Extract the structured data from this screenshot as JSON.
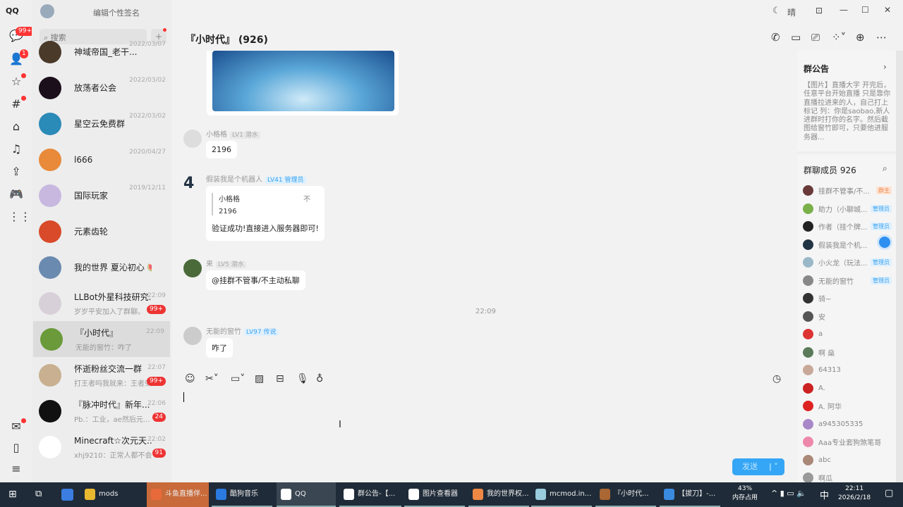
{
  "app": {
    "logo": "QQ",
    "signature": "编辑个性签名",
    "weather": "晴",
    "nav_badge": "99+",
    "contacts_badge": "1"
  },
  "search": {
    "placeholder": "搜索"
  },
  "conversations": [
    {
      "name": "神域帝国_老干...",
      "time": "2022/03/07",
      "sub": "",
      "badge": "",
      "color": "#4a3a2a"
    },
    {
      "name": "放荡者公会",
      "time": "2022/03/02",
      "sub": "",
      "badge": "",
      "color": "#1a0f1a"
    },
    {
      "name": "星空云免费群",
      "time": "2022/03/02",
      "sub": "",
      "badge": "",
      "color": "#2a8ab8"
    },
    {
      "name": "l666",
      "time": "2020/04/27",
      "sub": "",
      "badge": "",
      "color": "#e88a3a"
    },
    {
      "name": "国际玩家",
      "time": "2019/12/11",
      "sub": "",
      "badge": "",
      "color": "#c8b8e0"
    },
    {
      "name": "元素齿轮",
      "time": "",
      "sub": "",
      "badge": "",
      "color": "#d84a2a"
    },
    {
      "name": "我的世界 夏沁初心 🍉",
      "time": "",
      "sub": "",
      "badge": "",
      "color": "#6a8ab0"
    },
    {
      "name": "LLBot外星科技研究...",
      "time": "22:09",
      "sub": "岁岁平安加入了群聊。",
      "badge": "99+",
      "color": "#d8d0d8"
    },
    {
      "name": "『小时代』",
      "time": "22:09",
      "sub": "无能的窗竹：咋了",
      "badge": "",
      "color": "#6a9a3a",
      "selected": true
    },
    {
      "name": "怀逝粉丝交流一群",
      "time": "22:07",
      "sub": "打王者吗我就来：王者荣...",
      "badge": "99+",
      "color": "#c8b090"
    },
    {
      "name": "『脉冲时代』新年...",
      "time": "22:06",
      "sub": "Pb.：工业，ae然后元...",
      "badge": "24",
      "color": "#111"
    },
    {
      "name": "Minecraft☆次元天...",
      "time": "22:02",
      "sub": "xhj9210：正常人都不会买吧",
      "badge": "91",
      "color": "#fff"
    }
  ],
  "chat": {
    "title": "『小时代』 (926)",
    "messages": [
      {
        "sender": "小格格",
        "level": "LV1 潜水",
        "text": "2196"
      },
      {
        "sender": "假装我是个机器人",
        "level": "LV41 管理员",
        "quote_name": "小格格",
        "quote_text": "2196",
        "quote_mark": "不",
        "text": "验证成功!直接进入服务器即可!"
      },
      {
        "sender": "来",
        "level": "LV5 潜水",
        "text": "@挂群不管事/不主动私聊"
      },
      {
        "sender": "无能的窗竹",
        "level": "LV97 传说",
        "text": "咋了"
      }
    ],
    "time_separator": "22:09"
  },
  "composer": {
    "send_label": "发送"
  },
  "notice": {
    "title": "群公告",
    "text": "【图片】直播大字 开完后，任意平台开始直播 只是靠你直播拉进来的人，自己打上标记 列：你是saobao,新人进群时打你的名字。然后截图给窗竹即可，只要他进服务器..."
  },
  "members": {
    "title": "群聊成员 926",
    "list": [
      {
        "name": "挂群不管事/不...",
        "role": "群主",
        "color": "#6a3a3a"
      },
      {
        "name": "助力（小聊城...",
        "role": "管理员",
        "color": "#7ab04a"
      },
      {
        "name": "作者（挂个牌...",
        "role": "管理员",
        "color": "#222"
      },
      {
        "name": "假装我是个机...",
        "role": "",
        "color": "#234"
      },
      {
        "name": "小火龙（玩法...",
        "role": "管理员",
        "color": "#9ab8c8"
      },
      {
        "name": "无能的窗竹",
        "role": "管理员",
        "color": "#888"
      },
      {
        "name": "骑~",
        "role": "",
        "color": "#333"
      },
      {
        "name": "安",
        "role": "",
        "color": "#555"
      },
      {
        "name": "a",
        "role": "",
        "color": "#d33"
      },
      {
        "name": "啊 燊",
        "role": "",
        "color": "#5a7a5a"
      },
      {
        "name": "64313",
        "role": "",
        "color": "#c8a898"
      },
      {
        "name": "A.",
        "role": "",
        "color": "#c22"
      },
      {
        "name": "A. 阿华",
        "role": "",
        "color": "#d22"
      },
      {
        "name": "a945305335",
        "role": "",
        "color": "#a888c8"
      },
      {
        "name": "Aaa专业套狗煞笔哥",
        "role": "",
        "color": "#e8a"
      },
      {
        "name": "abc",
        "role": "",
        "color": "#a87"
      },
      {
        "name": "啊瓜",
        "role": "",
        "color": "#999"
      }
    ]
  },
  "taskbar": {
    "items": [
      "mods",
      "斗鱼直播伴...",
      "酷狗音乐",
      "QQ",
      "群公告-【...",
      "图片查看器",
      "我的世界权...",
      "mcmod.in...",
      "『小时代...",
      "【拔刀】-..."
    ],
    "memory_percent": "43%",
    "memory_label": "内存占用",
    "ime": "中",
    "time": "22:11",
    "date": "2026/2/18"
  }
}
